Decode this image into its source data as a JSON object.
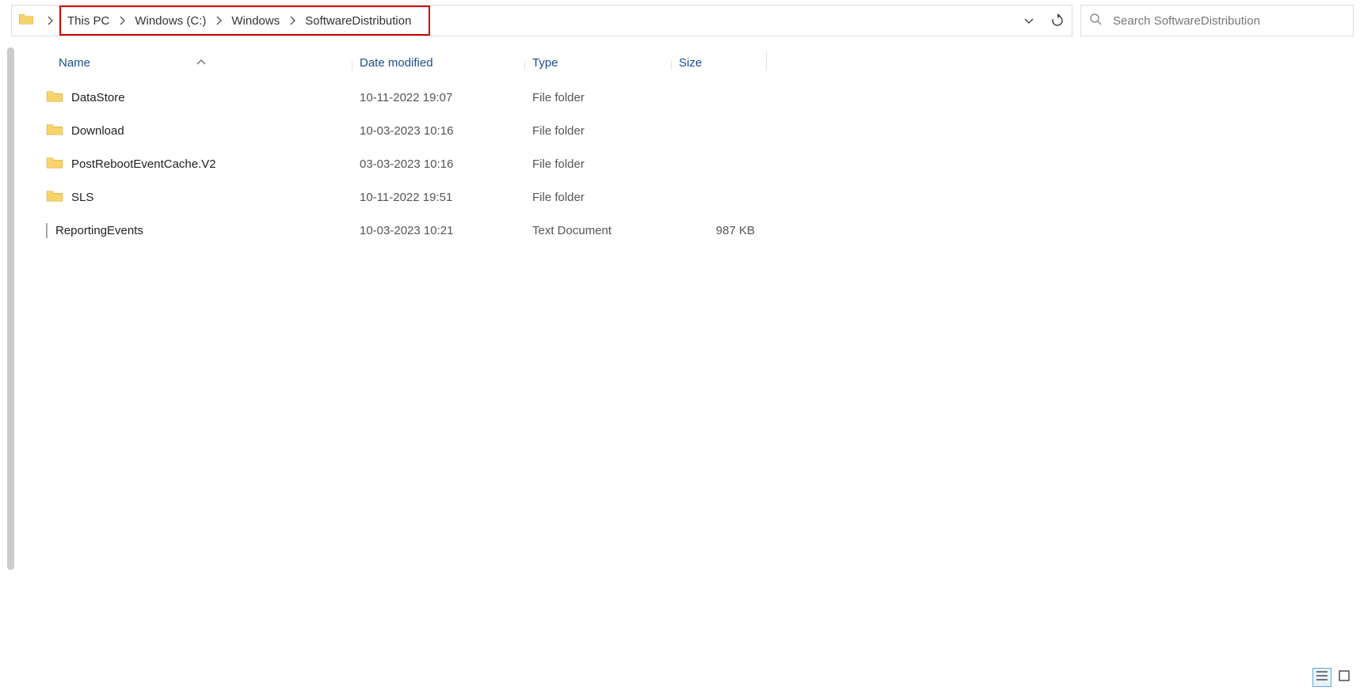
{
  "breadcrumb": {
    "segments": [
      "This PC",
      "Windows (C:)",
      "Windows",
      "SoftwareDistribution"
    ]
  },
  "search": {
    "placeholder": "Search SoftwareDistribution"
  },
  "columns": {
    "name": "Name",
    "date": "Date modified",
    "type": "Type",
    "size": "Size"
  },
  "items": [
    {
      "icon": "folder",
      "name": "DataStore",
      "date": "10-11-2022 19:07",
      "type": "File folder",
      "size": ""
    },
    {
      "icon": "folder",
      "name": "Download",
      "date": "10-03-2023 10:16",
      "type": "File folder",
      "size": ""
    },
    {
      "icon": "folder",
      "name": "PostRebootEventCache.V2",
      "date": "03-03-2023 10:16",
      "type": "File folder",
      "size": ""
    },
    {
      "icon": "folder",
      "name": "SLS",
      "date": "10-11-2022 19:51",
      "type": "File folder",
      "size": ""
    },
    {
      "icon": "file",
      "name": "ReportingEvents",
      "date": "10-03-2023 10:21",
      "type": "Text Document",
      "size": "987 KB"
    }
  ]
}
